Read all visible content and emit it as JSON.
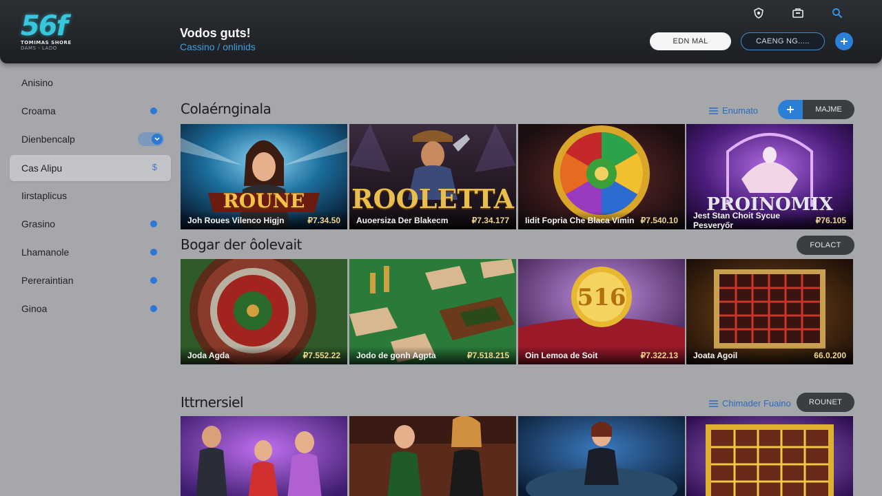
{
  "header": {
    "logo_mark": "56f",
    "logo_line1": "TOMIMAS SHORE",
    "logo_line2": "DAMS - LADO",
    "title": "Vodos guts!",
    "subtitle": "Cassino / onlinids",
    "icons": [
      "shield-icon",
      "briefcase-icon",
      "search-icon"
    ],
    "email_button": "EDN MAL",
    "casino_button": "CAENG NG.....",
    "plus_icon": "plus-icon",
    "accent": "#2c7fd6"
  },
  "sidebar": {
    "items": [
      {
        "label": "Anisino",
        "indicator": "none"
      },
      {
        "label": "Croama",
        "indicator": "dot"
      },
      {
        "label": "Dienbencalp",
        "indicator": "toggle"
      },
      {
        "label": "Cas Alipu",
        "indicator": "dollar",
        "active": true
      },
      {
        "label": "Iirstaplicus",
        "indicator": "none"
      },
      {
        "label": "Grasino",
        "indicator": "dot"
      },
      {
        "label": "Lhamanole",
        "indicator": "dot"
      },
      {
        "label": "Pereraintian",
        "indicator": "dot"
      },
      {
        "label": "Ginoa",
        "indicator": "dot"
      }
    ],
    "dollar_symbol": "$"
  },
  "sections": [
    {
      "title": "Colaérnginala",
      "link": "Enumato",
      "button": "MAJME",
      "cards": [
        {
          "art_text": "ROUNE",
          "name": "Joh Roues Vilenco Higjn",
          "price": "₽7.34.50"
        },
        {
          "art_text": "ROOLETTA",
          "name": "Auoersiza Der Blakecm",
          "price": "₽7.34.177"
        },
        {
          "art_text": "",
          "name": "Iidit Fopria Che Blaca Vimin",
          "price": "₽7.540.10"
        },
        {
          "art_text": "PROINOMIX",
          "name": "Jest Stan Choit Sycue Pesveryőr",
          "price": "₽76.105"
        }
      ]
    },
    {
      "title": "Bogar der ôolevait",
      "link": "",
      "button": "FOLACT",
      "cards": [
        {
          "art_text": "",
          "name": "Joda Agda",
          "price": "₽7.552.22"
        },
        {
          "art_text": "",
          "name": "Jodo de gonh Agpta",
          "price": "₽7.518.215"
        },
        {
          "art_text": "516",
          "name": "Oin Lemoa de Soit",
          "price": "₽7.322.13"
        },
        {
          "art_text": "",
          "name": "Joata Agoil",
          "price": "66.0.200"
        }
      ]
    },
    {
      "title": "Ittrnersiel",
      "link": "Chimader Fuaino",
      "button": "ROUNET",
      "cards": [
        {
          "art_text": "",
          "name": "",
          "price": ""
        },
        {
          "art_text": "",
          "name": "",
          "price": ""
        },
        {
          "art_text": "",
          "name": "",
          "price": ""
        },
        {
          "art_text": "",
          "name": "",
          "price": ""
        }
      ]
    }
  ]
}
